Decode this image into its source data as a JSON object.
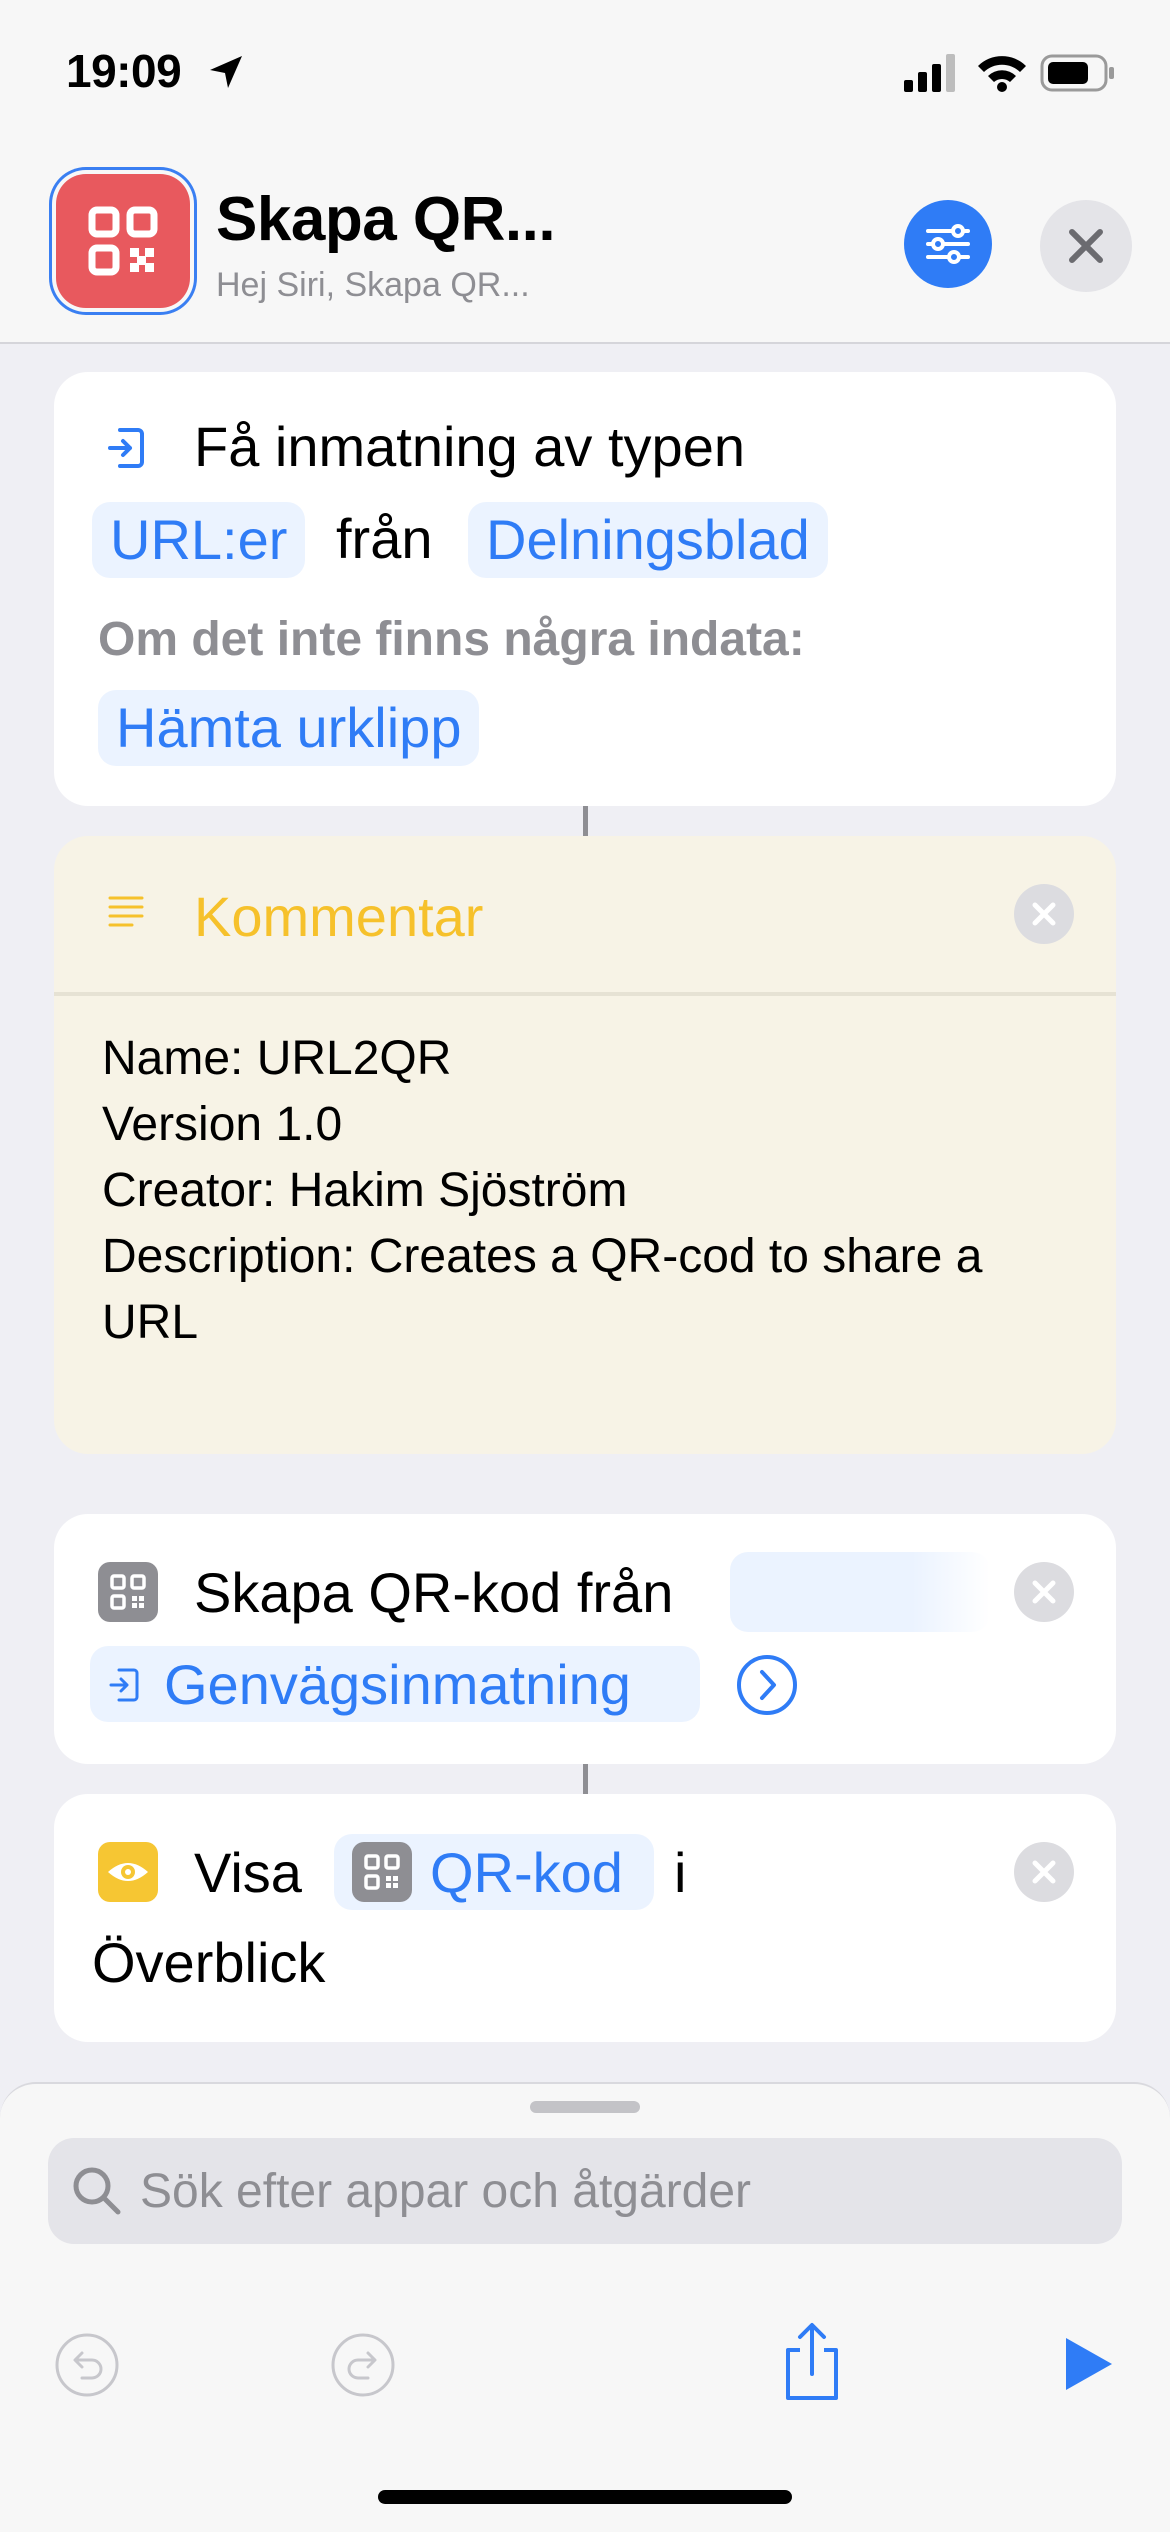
{
  "status_bar": {
    "time": "19:09"
  },
  "header": {
    "title": "Skapa QR...",
    "subtitle": "Hej Siri, Skapa QR..."
  },
  "action_get_input": {
    "title": "Få inmatning av typen",
    "type_value": "URL:er",
    "from_word": "från",
    "source_value": "Delningsblad",
    "fallback_label": "Om det inte finns några indata:",
    "fallback_value": "Hämta urklipp"
  },
  "comment": {
    "title": "Kommentar",
    "body": "Name: URL2QR\nVersion 1.0\nCreator: Hakim Sjöström\nDescription: Creates a QR-cod to share a URL"
  },
  "action_qr": {
    "title": "Skapa QR-kod från",
    "input_value": "Genvägsinmatning"
  },
  "action_show": {
    "verb": "Visa",
    "value": "QR-kod",
    "suffix": "i",
    "line2": "Överblick"
  },
  "search": {
    "placeholder": "Sök efter appar och åtgärder"
  },
  "colors": {
    "accent": "#2f7cf6",
    "app_icon": "#e8595e",
    "comment_yellow": "#f6c12b",
    "comment_bg": "#f7f3e6"
  },
  "icons": {
    "location": "location-arrow-icon",
    "signal": "signal-icon",
    "wifi": "wifi-icon",
    "battery": "battery-icon",
    "app": "qr-code-icon",
    "settings": "sliders-icon",
    "close": "close-icon",
    "input": "input-icon",
    "comment": "text-lines-icon",
    "qr_action": "qr-code-icon",
    "show": "eye-icon",
    "search": "search-icon",
    "undo": "undo-icon",
    "redo": "redo-icon",
    "share": "share-icon",
    "play": "play-icon"
  }
}
